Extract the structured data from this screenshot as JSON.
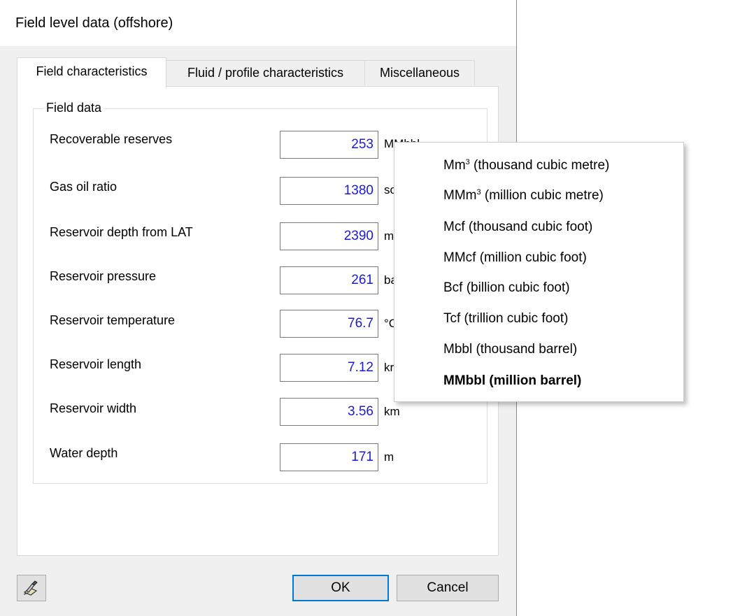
{
  "window": {
    "title": "Field level data (offshore)"
  },
  "tabs": [
    {
      "label": "Field characteristics",
      "active": true
    },
    {
      "label": "Fluid / profile characteristics",
      "active": false
    },
    {
      "label": "Miscellaneous",
      "active": false
    }
  ],
  "group": {
    "label": "Field data"
  },
  "fields": [
    {
      "label": "Recoverable reserves",
      "value": "253",
      "unit": "MMbbl"
    },
    {
      "label": "Gas oil ratio",
      "value": "1380",
      "unit": "sc"
    },
    {
      "label": "Reservoir depth from LAT",
      "value": "2390",
      "unit": "m"
    },
    {
      "label": "Reservoir pressure",
      "value": "261",
      "unit": "ba"
    },
    {
      "label": "Reservoir temperature",
      "value": "76.7",
      "unit": "°C"
    },
    {
      "label": "Reservoir length",
      "value": "7.12",
      "unit": "kr"
    },
    {
      "label": "Reservoir width",
      "value": "3.56",
      "unit": "km"
    },
    {
      "label": "Water depth",
      "value": "171",
      "unit": "m"
    }
  ],
  "buttons": {
    "ok": "OK",
    "cancel": "Cancel",
    "settings_icon": "settings-wand-icon"
  },
  "unit_menu": {
    "items": [
      {
        "pre": "Mm",
        "sup": "3",
        "post": " (thousand cubic metre)",
        "selected": false
      },
      {
        "pre": "MMm",
        "sup": "3",
        "post": " (million cubic metre)",
        "selected": false
      },
      {
        "pre": "Mcf (thousand cubic foot)",
        "sup": "",
        "post": "",
        "selected": false
      },
      {
        "pre": "MMcf (million cubic foot)",
        "sup": "",
        "post": "",
        "selected": false
      },
      {
        "pre": "Bcf (billion cubic foot)",
        "sup": "",
        "post": "",
        "selected": false
      },
      {
        "pre": "Tcf (trillion cubic foot)",
        "sup": "",
        "post": "",
        "selected": false
      },
      {
        "pre": "Mbbl (thousand barrel)",
        "sup": "",
        "post": "",
        "selected": false
      },
      {
        "pre": "MMbbl (million barrel)",
        "sup": "",
        "post": "",
        "selected": true
      }
    ]
  },
  "colors": {
    "value_text": "#1a1ad6",
    "ok_border": "#0078d7",
    "dialog_bg": "#f0f0f0"
  }
}
